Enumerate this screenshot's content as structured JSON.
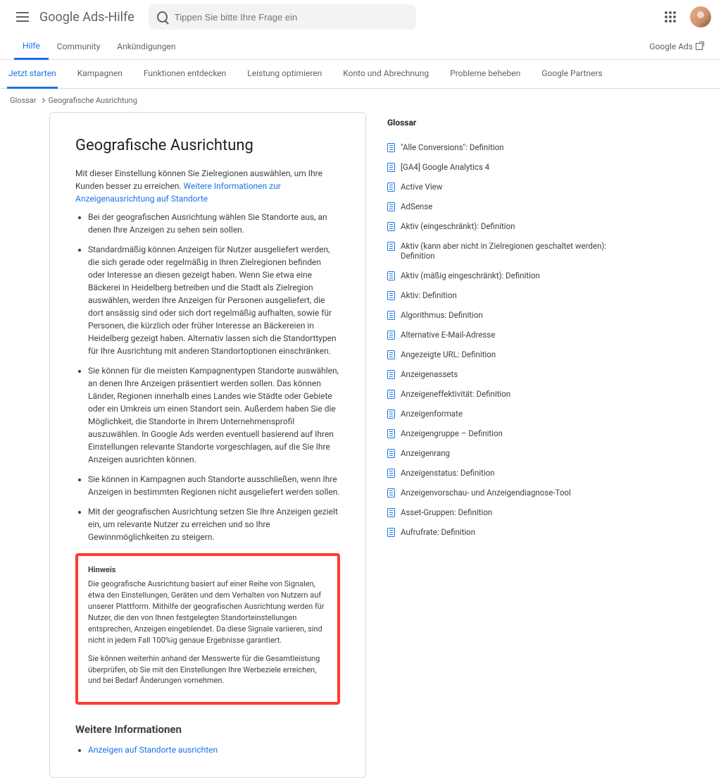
{
  "header": {
    "site_title": "Google Ads-Hilfe",
    "search_placeholder": "Tippen Sie bitte Ihre Frage ein"
  },
  "tabs1": {
    "items": [
      "Hilfe",
      "Community",
      "Ankündigungen"
    ],
    "external": "Google Ads"
  },
  "tabs2": {
    "items": [
      "Jetzt starten",
      "Kampagnen",
      "Funktionen entdecken",
      "Leistung optimieren",
      "Konto und Abrechnung",
      "Probleme beheben",
      "Google Partners"
    ]
  },
  "breadcrumb": {
    "root": "Glossar",
    "current": "Geografische Ausrichtung"
  },
  "article": {
    "title": "Geografische Ausrichtung",
    "intro": "Mit dieser Einstellung können Sie Zielregionen auswählen, um Ihre Kunden besser zu erreichen.",
    "intro_link": "Weitere Informationen zur Anzeigenausrichtung auf Standorte",
    "bullets": [
      "Bei der geografischen Ausrichtung wählen Sie Standorte aus, an denen Ihre Anzeigen zu sehen sein sollen.",
      "Standardmäßig können Anzeigen für Nutzer ausgeliefert werden, die sich gerade oder regelmäßig in Ihren Zielregionen befinden oder Interesse an diesen gezeigt haben. Wenn Sie etwa eine Bäckerei in Heidelberg betreiben und die Stadt als Zielregion auswählen, werden Ihre Anzeigen für Personen ausgeliefert, die dort ansässig sind oder sich dort regelmäßig aufhalten, sowie für Personen, die kürzlich oder früher Interesse an Bäckereien in Heidelberg gezeigt haben. Alternativ lassen sich die Standorttypen für Ihre Ausrichtung mit anderen Standortoptionen einschränken.",
      "Sie können für die meisten Kampagnentypen Standorte auswählen, an denen Ihre Anzeigen präsentiert werden sollen. Das können Länder, Regionen innerhalb eines Landes wie Städte oder Gebiete oder ein Umkreis um einen Standort sein. Außerdem haben Sie die Möglichkeit, die Standorte in Ihrem Unternehmensprofil auszuwählen. In Google Ads werden eventuell basierend auf Ihren Einstellungen relevante Standorte vorgeschlagen, auf die Sie Ihre Anzeigen ausrichten können.",
      "Sie können in Kampagnen auch Standorte ausschließen, wenn Ihre Anzeigen in bestimmten Regionen nicht ausgeliefert werden sollen.",
      "Mit der geografischen Ausrichtung setzen Sie Ihre Anzeigen gezielt ein, um relevante Nutzer zu erreichen und so Ihre Gewinnmöglichkeiten zu steigern."
    ],
    "note": {
      "heading": "Hinweis",
      "p1": "Die geografische Ausrichtung basiert auf einer Reihe von Signalen, etwa den Einstellungen, Geräten und dem Verhalten von Nutzern auf unserer Plattform. Mithilfe der geografischen Ausrichtung werden für Nutzer, die den von Ihnen festgelegten Standorteinstellungen entsprechen, Anzeigen eingeblendet. Da diese Signale variieren, sind nicht in jedem Fall 100%ig genaue Ergebnisse garantiert.",
      "p2": "Sie können weiterhin anhand der Messwerte für die Gesamtleistung überprüfen, ob Sie mit den Einstellungen Ihre Werbeziele erreichen, und bei Bedarf Änderungen vornehmen."
    },
    "more_heading": "Weitere Informationen",
    "more_links": [
      "Anzeigen auf Standorte ausrichten"
    ]
  },
  "glossary": {
    "heading": "Glossar",
    "items": [
      "\"Alle Conversions\": Definition",
      "[GA4] Google Analytics 4",
      "Active View",
      "AdSense",
      "Aktiv (eingeschränkt): Definition",
      "Aktiv (kann aber nicht in Zielregionen geschaltet werden): Definition",
      "Aktiv (mäßig eingeschränkt): Definition",
      "Aktiv: Definition",
      "Algorithmus: Definition",
      "Alternative E-Mail-Adresse",
      "Angezeigte URL: Definition",
      "Anzeigenassets",
      "Anzeigeneffektivität: Definition",
      "Anzeigenformate",
      "Anzeigengruppe – Definition",
      "Anzeigenrang",
      "Anzeigenstatus: Definition",
      "Anzeigenvorschau- und Anzeigendiagnose-Tool",
      "Asset-Gruppen: Definition",
      "Aufrufrate: Definition"
    ]
  }
}
